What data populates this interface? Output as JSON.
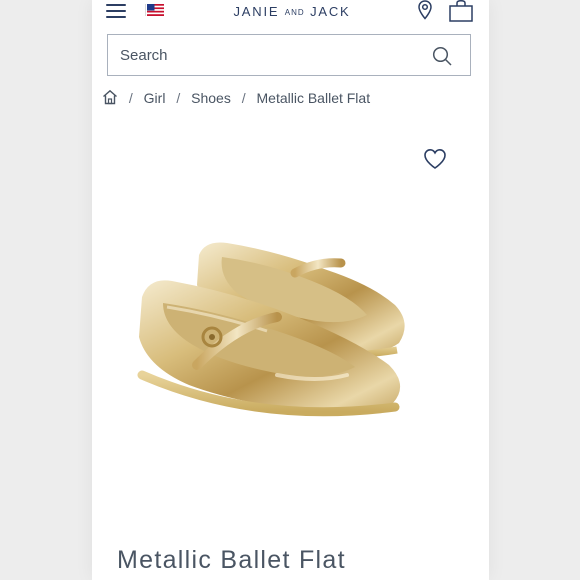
{
  "header": {
    "brand_main_left": "JANIE",
    "brand_and": "AND",
    "brand_main_right": "JACK",
    "menu_icon": "hamburger-menu-icon",
    "flag_icon": "us-flag-icon",
    "store_icon": "location-pin-icon",
    "bag_icon": "shopping-bag-icon"
  },
  "search": {
    "placeholder": "Search",
    "icon": "search-icon"
  },
  "breadcrumb": {
    "home_icon": "home-icon",
    "items": [
      "Girl",
      "Shoes",
      "Metallic Ballet Flat"
    ]
  },
  "product": {
    "title": "Metallic Ballet Flat",
    "wishlist_icon": "heart-icon",
    "image_desc_colors": {
      "gold": "#c9a860",
      "brand_navy": "#2c3e63"
    }
  }
}
